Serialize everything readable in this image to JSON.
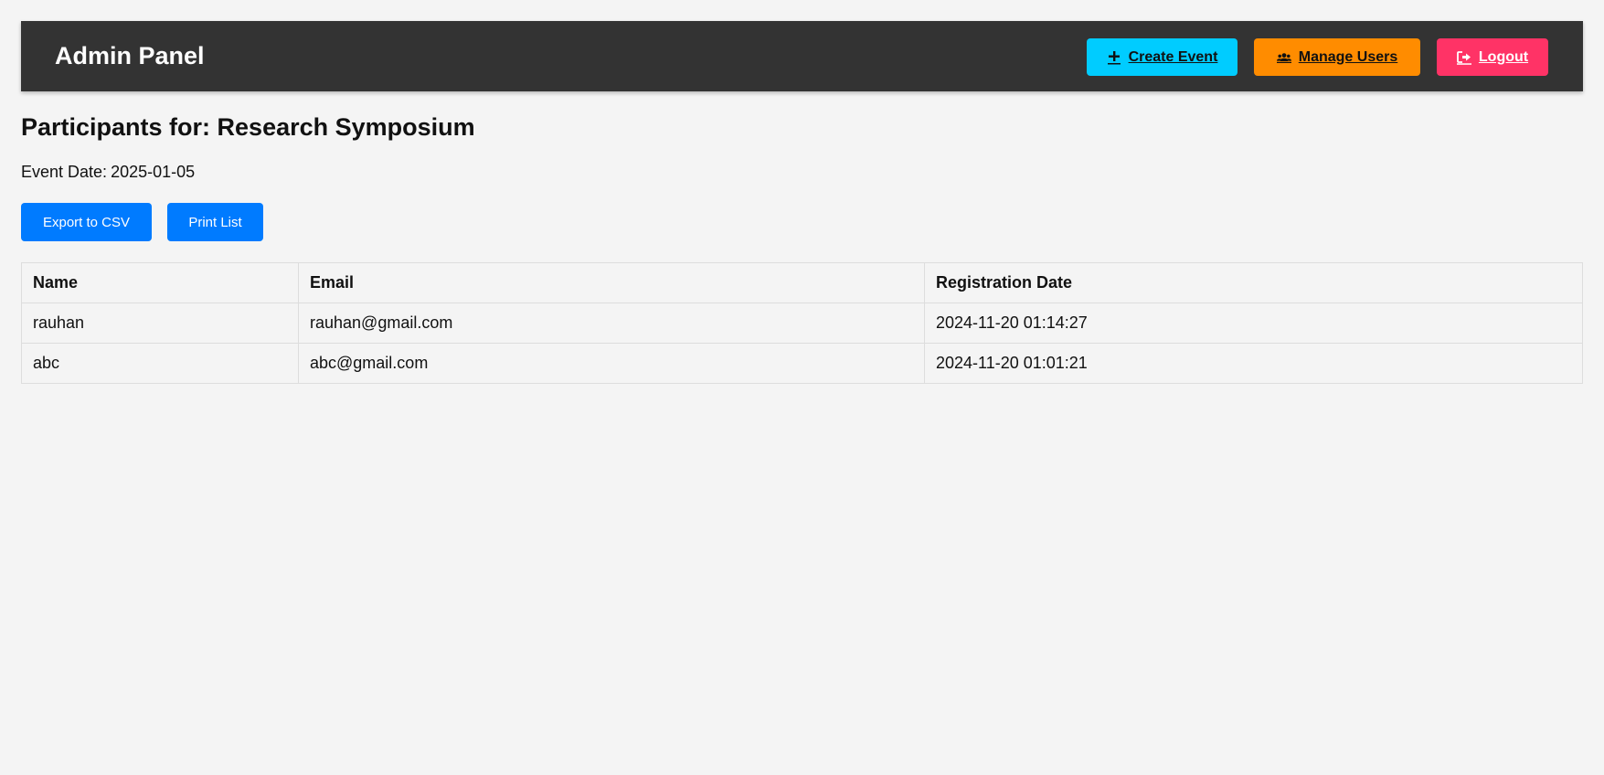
{
  "header": {
    "title": "Admin Panel",
    "nav": {
      "create_event": {
        "label": "Create Event",
        "icon": "plus-icon",
        "color": "#00ccff"
      },
      "manage_users": {
        "label": "Manage Users",
        "icon": "users-icon",
        "color": "#ff8c00"
      },
      "logout": {
        "label": "Logout",
        "icon": "sign-out-icon",
        "color": "#ff3366"
      }
    }
  },
  "main": {
    "title": "Participants for: Research Symposium",
    "event_date_label": "Event Date:",
    "event_date": "2025-01-05",
    "actions": {
      "export_label": "Export to CSV",
      "print_label": "Print List",
      "color": "#007bff"
    },
    "table": {
      "columns": [
        "Name",
        "Email",
        "Registration Date"
      ],
      "rows": [
        {
          "name": "rauhan",
          "email": "rauhan@gmail.com",
          "registration_date": "2024-11-20 01:14:27"
        },
        {
          "name": "abc",
          "email": "abc@gmail.com",
          "registration_date": "2024-11-20 01:01:21"
        }
      ]
    }
  }
}
